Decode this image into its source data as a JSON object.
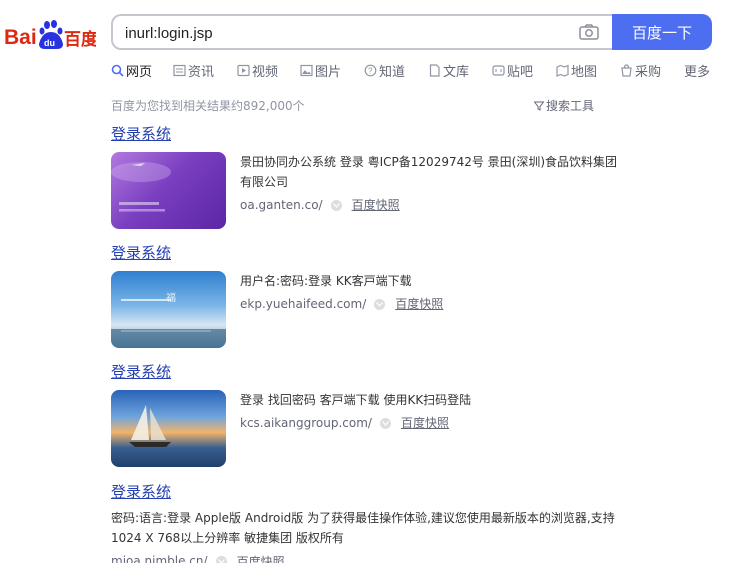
{
  "header": {
    "logo_text_left": "Bai",
    "logo_text_mid": "du",
    "logo_text_right": "百度",
    "search_value": "inurl:login.jsp",
    "search_button": "百度一下"
  },
  "tabs": [
    {
      "label": "网页",
      "icon": "search-icon"
    },
    {
      "label": "资讯",
      "icon": "news-icon"
    },
    {
      "label": "视频",
      "icon": "video-icon"
    },
    {
      "label": "图片",
      "icon": "image-icon"
    },
    {
      "label": "知道",
      "icon": "question-icon"
    },
    {
      "label": "文库",
      "icon": "doc-icon"
    },
    {
      "label": "贴吧",
      "icon": "tieba-icon"
    },
    {
      "label": "地图",
      "icon": "map-icon"
    },
    {
      "label": "采购",
      "icon": "shopping-icon"
    },
    {
      "label": "更多",
      "icon": ""
    }
  ],
  "result_count": "百度为您找到相关结果约892,000个",
  "search_tools": "搜索工具",
  "results": [
    {
      "title": "登录系统",
      "abstract": "景田协同办公系统 登录 粤ICP备12029742号 景田(深圳)食品饮料集团有限公司",
      "url": "oa.ganten.co/",
      "snapshot": "百度快照",
      "thumb_color": "#8a4fc9"
    },
    {
      "title": "登录系统",
      "abstract": "用户名:密码:登录 KK客戸端下载",
      "url": "ekp.yuehaifeed.com/",
      "snapshot": "百度快照",
      "thumb_color": "#3b8fd6"
    },
    {
      "title": "登录系统",
      "abstract": "登录 找回密码 客戸端下载 使用KK扫码登陆",
      "url": "kcs.aikanggroup.com/",
      "snapshot": "百度快照",
      "thumb_color": "#e08a3c"
    },
    {
      "title": "登录系统",
      "abstract": "密码:语言:登录 Apple版 Android版 为了获得最佳操作体验,建议您使用最新版本的浏览器,支持1024 X 768以上分辨率 敏捷集团 版权所有",
      "url": "mjoa.nimble.cn/",
      "snapshot": "百度快照"
    }
  ],
  "colors": {
    "accent": "#4e6ef2",
    "link": "#2440b3",
    "logo_red": "#de2910",
    "logo_blue": "#2932e1"
  }
}
